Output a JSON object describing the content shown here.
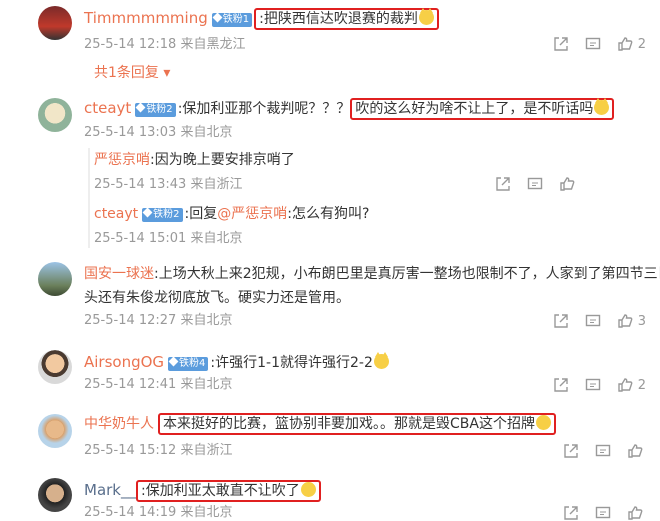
{
  "comments": [
    {
      "user": "Timmmmmming",
      "badge": "铁粉1",
      "text": ":把陕西信达吹退赛的裁判",
      "meta": "25-5-14 12:18 来自黑龙江",
      "likes": "2",
      "more": "共1条回复"
    },
    {
      "user": "cteayt",
      "badge": "铁粉2",
      "text_plain": ":保加利亚那个裁判呢？？？",
      "text_highlight": "吹的这么好为啥不让上了，是不听话吗",
      "meta": "25-5-14 13:03 来自北京",
      "replies": [
        {
          "user": "严惩京哨",
          "text": ":因为晚上要安排京哨了",
          "meta": "25-5-14 13:43 来自浙江"
        },
        {
          "user": "cteayt",
          "badge": "铁粉2",
          "text_prefix": ":回复",
          "mention": "@严惩京哨",
          "text": ":怎么有狗叫?",
          "meta": "25-5-14 15:01 来自北京"
        }
      ]
    },
    {
      "user": "国安一球迷",
      "text1": ":上场大秋上来2犯规，小布朗巴里是真厉害一整场也限制不了，人家到了第四节三巨",
      "text2": "头还有朱俊龙彻底放飞。硬实力还是管用。",
      "meta": "25-5-14 12:27 来自北京",
      "likes": "3"
    },
    {
      "user": "AirsongOG",
      "badge": "铁粉4",
      "text": ":许强行1-1就得许强行2-2",
      "meta": "25-5-14 12:41 来自北京",
      "likes": "2"
    },
    {
      "user": "中华奶牛人",
      "text": "本来挺好的比赛，篮协别非要加戏。。那就是毁CBA这个招牌",
      "meta": "25-5-14 15:12 来自浙江"
    },
    {
      "user": "Mark__",
      "text": ":保加利亚太敢直不让吹了",
      "meta": "25-5-14 14:19 来自北京"
    }
  ],
  "icons": [
    "share-icon",
    "comment-icon",
    "like-icon"
  ]
}
